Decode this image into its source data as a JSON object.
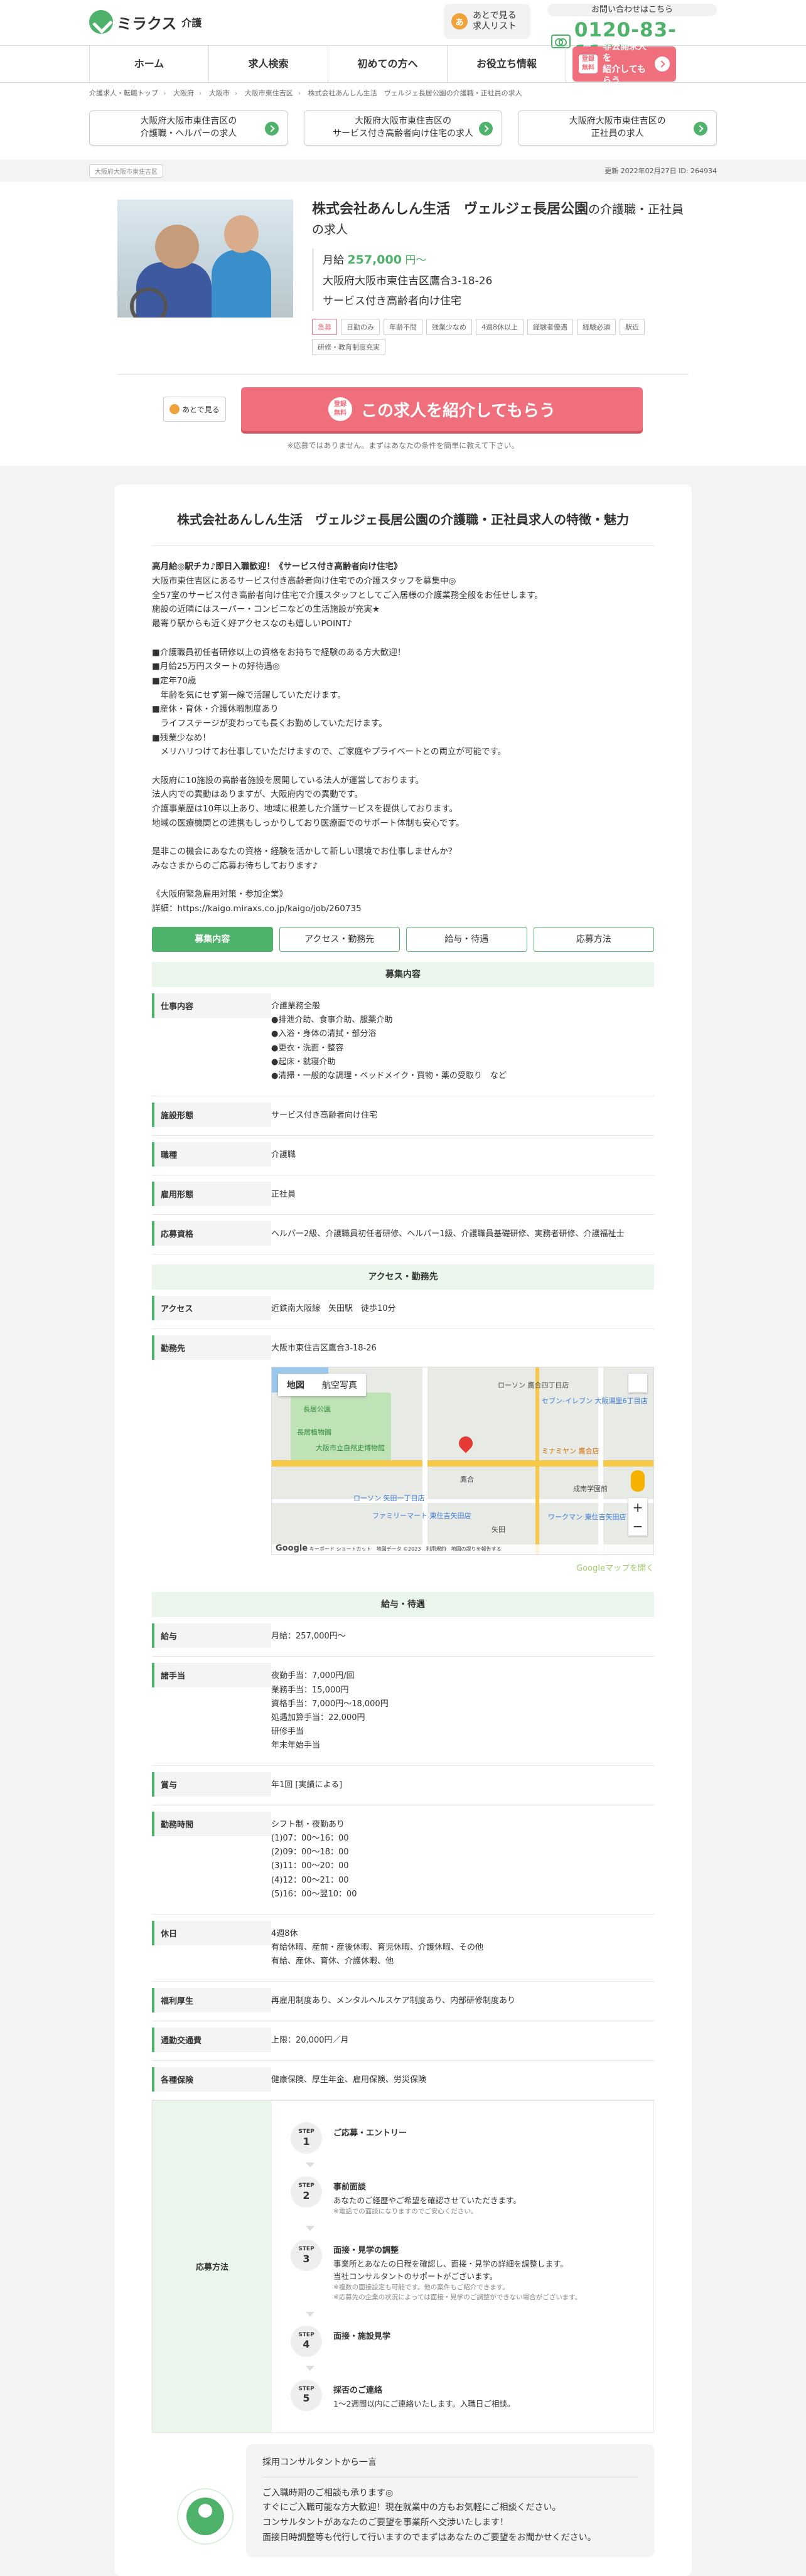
{
  "header": {
    "logo_text": "ミラクス",
    "logo_sub": "介護",
    "later_label": "あとで見る\n求人リスト",
    "later_icon_text": "あ",
    "contact_label": "お問い合わせはこちら",
    "phone": "0120-83-1155"
  },
  "nav": {
    "items": [
      "ホーム",
      "求人検索",
      "初めての方へ",
      "お役立ち情報"
    ],
    "cta_badge": "登録\n無料",
    "cta_label": "非公開求人を\n紹介してもらう"
  },
  "breadcrumb": [
    "介護求人・転職トップ",
    "大阪府",
    "大阪市",
    "大阪市東住吉区",
    "株式会社あんしん生活　ヴェルジェ長居公園の介護職・正社員の求人"
  ],
  "area_links": [
    "大阪府大阪市東住吉区の\n介護職・ヘルパーの求人",
    "大阪府大阪市東住吉区の\nサービス付き高齢者向け住宅の求人",
    "大阪府大阪市東住吉区の\n正社員の求人"
  ],
  "meta": {
    "tag": "大阪府大阪市東住吉区",
    "updated": "更新 2022年02月27日 ID: 264934"
  },
  "job": {
    "title_bold": "株式会社あんしん生活　ヴェルジェ長居公園",
    "title_suffix": "の介護職・正社員の求人",
    "salary_prefix": "月給",
    "salary_value": "257,000",
    "salary_suffix": "円〜",
    "address": "大阪府大阪市東住吉区鷹合3-18-26",
    "facility": "サービス付き高齢者向け住宅",
    "tags": [
      "急募",
      "日勤のみ",
      "年齢不問",
      "残業少なめ",
      "4週8休以上",
      "経験者優遇",
      "経験必須",
      "駅近",
      "研修・教育制度充実"
    ],
    "later_label": "あとで見る",
    "cta_badge": "登録\n無料",
    "cta_label": "この求人を紹介してもらう",
    "cta_note": "※応募ではありません。まずはあなたの条件を簡単に教えて下さい。"
  },
  "card": {
    "title": "株式会社あんしん生活　ヴェルジェ長居公園の介護職・正社員求人の特徴・魅力",
    "lead": "高月給◎駅チカ♪即日入職歓迎！《サービス付き高齢者向け住宅》",
    "desc": "大阪市東住吉区にあるサービス付き高齢者向け住宅での介護スタッフを募集中◎\n全57室のサービス付き高齢者向け住宅で介護スタッフとしてご入居様の介護業務全般をお任せします。\n施設の近隣にはスーパー・コンビニなどの生活施設が充実★\n最寄り駅からも近く好アクセスなのも嬉しいPOINT♪\n\n■介護職員初任者研修以上の資格をお持ちで経験のある方大歓迎！\n■月給25万円スタートの好待遇◎\n■定年70歳\n　年齢を気にせず第一線で活躍していただけます。\n■産休・育休・介護休暇制度あり\n　ライフステージが変わっても長くお勤めしていただけます。\n■残業少なめ！\n　メリハリつけてお仕事していただけますので、ご家庭やプライベートとの両立が可能です。\n\n大阪府に10施設の高齢者施設を展開している法人が運営しております。\n法人内での異動はありますが、大阪府内での異動です。\n介護事業歴は10年以上あり、地域に根差した介護サービスを提供しております。\n地域の医療機関との連携もしっかりしており医療面でのサポート体制も安心です。\n\n是非この機会にあなたの資格・経験を活かして新しい環境でお仕事しませんか？\nみなさまからのご応募お待ちしております♪\n\n《大阪府緊急雇用対策・参加企業》\n詳細：https://kaigo.miraxs.co.jp/kaigo/job/260735",
    "tabs": [
      "募集内容",
      "アクセス・勤務先",
      "給与・待遇",
      "応募方法"
    ]
  },
  "sections": {
    "recruit": {
      "head": "募集内容",
      "rows": [
        {
          "label": "仕事内容",
          "value": "介護業務全般\n●排泄介助、食事介助、服薬介助\n●入浴・身体の清拭・部分浴\n●更衣・洗面・整容\n●起床・就寝介助\n●清掃・一般的な調理・ベッドメイク・買物・薬の受取り　など"
        },
        {
          "label": "施設形態",
          "value": "サービス付き高齢者向け住宅"
        },
        {
          "label": "職種",
          "value": "介護職"
        },
        {
          "label": "雇用形態",
          "value": "正社員"
        },
        {
          "label": "応募資格",
          "value": "ヘルパー2級、介護職員初任者研修、ヘルパー1級、介護職員基礎研修、実務者研修、介護福祉士"
        }
      ]
    },
    "access": {
      "head": "アクセス・勤務先",
      "access_label": "アクセス",
      "access_value": "近鉄南大阪線　矢田駅　徒歩10分",
      "office_label": "勤務先",
      "office_value": "大阪市東住吉区鷹合3-18-26",
      "map_tab_map": "地図",
      "map_tab_sat": "航空写真",
      "map_google": "Google",
      "map_footer": "キーボード ショートカット　地図データ ©2023　利用規約　地図の誤りを報告する",
      "map_labels": [
        "ローソン 鷹合四丁目店",
        "セブン-イレブン 大阪湯里6丁目店",
        "長居公園",
        "大阪市立自然史博物館",
        "長居植物園",
        "ミナミヤン 鷹合店",
        "ローソン 矢田一丁目店",
        "ファミリーマート 東住吉矢田店",
        "ワークマン 東住吉矢田店",
        "鷹合",
        "矢田",
        "成南学園前"
      ],
      "map_open": "Googleマップを開く"
    },
    "pay": {
      "head": "給与・待遇",
      "rows": [
        {
          "label": "給与",
          "value": "月給：257,000円〜"
        },
        {
          "label": "諸手当",
          "value": "夜勤手当：7,000円/回\n業務手当：15,000円\n資格手当：7,000円〜18,000円\n処遇加算手当：22,000円\n研修手当\n年末年始手当"
        },
        {
          "label": "賞与",
          "value": "年1回 [実績による]"
        },
        {
          "label": "勤務時間",
          "value": "シフト制・夜勤あり\n(1)07：00〜16：00\n(2)09：00〜18：00\n(3)11：00〜20：00\n(4)12：00〜21：00\n(5)16：00〜翌10：00"
        },
        {
          "label": "休日",
          "value": "4週8休\n有給休暇、産前・産後休暇、育児休暇、介護休暇、その他\n有給、産休、育休、介護休暇、他"
        },
        {
          "label": "福利厚生",
          "value": "再雇用制度あり、メンタルヘルスケア制度あり、内部研修制度あり"
        },
        {
          "label": "通勤交通費",
          "value": "上限：20,000円／月"
        },
        {
          "label": "各種保険",
          "value": "健康保険、厚生年金、雇用保険、労災保険"
        }
      ]
    },
    "apply": {
      "label": "応募方法",
      "step_word": "STEP",
      "steps": [
        {
          "n": "1",
          "title": "ご応募・エントリー",
          "text": "",
          "note": ""
        },
        {
          "n": "2",
          "title": "事前面談",
          "text": "あなたのご経歴やご希望を確認させていただきます。",
          "note": "※電話での面談になりますのでご安心ください。"
        },
        {
          "n": "3",
          "title": "面接・見学の調整",
          "text": "事業所とあなたの日程を確認し、面接・見学の詳細を調整します。\n当社コンサルタントのサポートがございます。",
          "note": "※複数の面接設定も可能です。他の案件もご紹介できます。\n※応募先の企業の状況によっては面接・見学のご調整ができない場合がございます。"
        },
        {
          "n": "4",
          "title": "面接・施設見学",
          "text": "",
          "note": ""
        },
        {
          "n": "5",
          "title": "採否のご連絡",
          "text": "1〜2週間以内にご連絡いたします。入職日ご相談。",
          "note": ""
        }
      ]
    }
  },
  "consultant": {
    "title": "採用コンサルタントから一言",
    "text": "ご入職時期のご相談も承ります◎\nすぐにご入職可能な方大歓迎！現在就業中の方もお気軽にご相談ください。\nコンサルタントがあなたのご要望を事業所へ交渉いたします！\n面接日時調整等も代行して行いますのでまずはあなたのご要望をお聞かせください。"
  }
}
